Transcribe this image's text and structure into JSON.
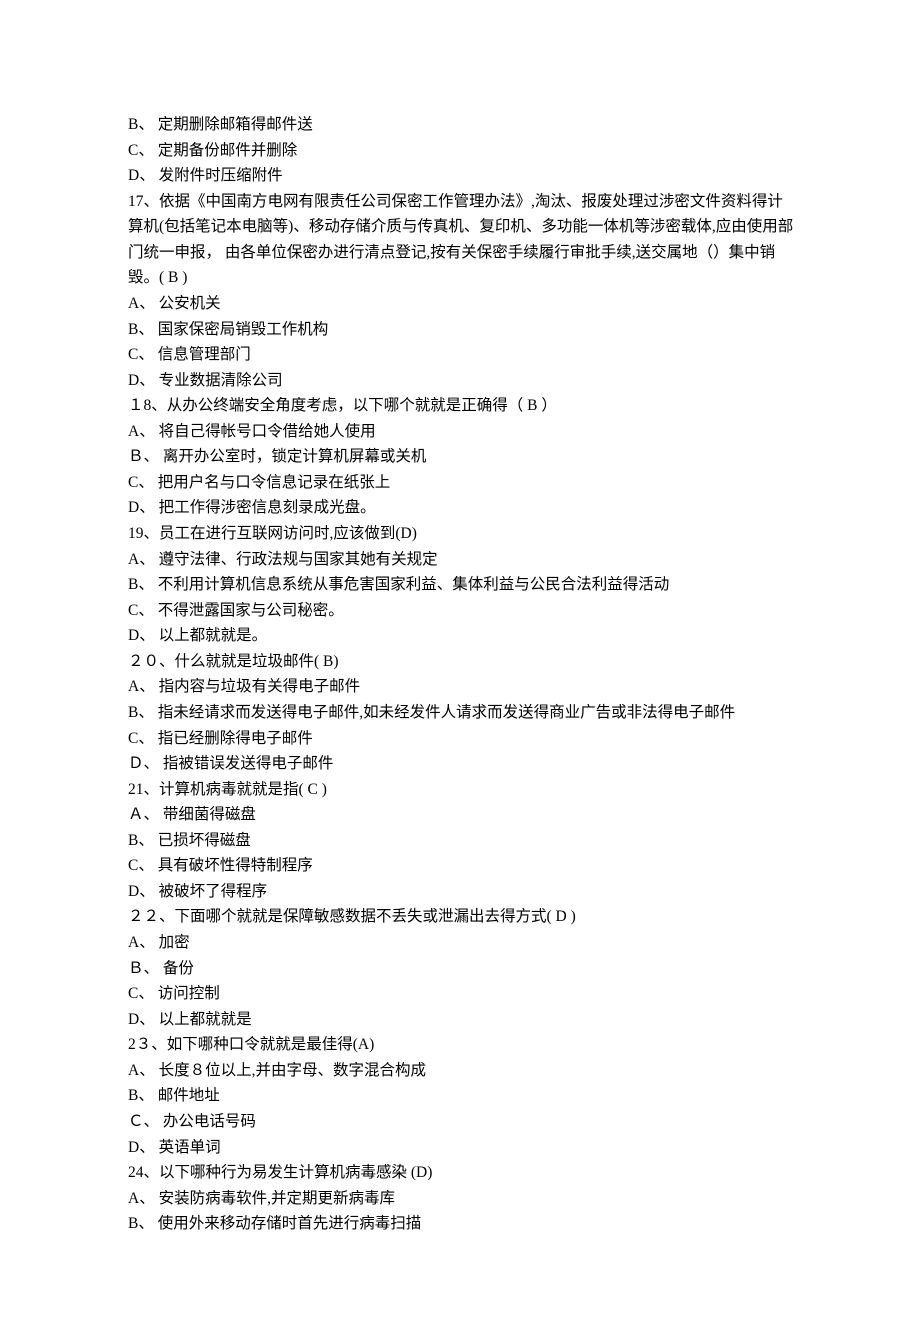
{
  "lines": [
    "B、  定期删除邮箱得邮件送",
    "C、   定期备份邮件并删除",
    "D、  发附件时压缩附件",
    "17、依据《中国南方电网有限责任公司保密工作管理办法》,淘汰、报废处理过涉密文件资料得计算机(包括笔记本电脑等)、移动存储介质与传真机、复印机、多功能一体机等涉密载体,应由使用部门统一申报， 由各单位保密办进行清点登记,按有关保密手续履行审批手续,送交属地（）集中销毁。(    B    )",
    "A、   公安机关",
    "B、   国家保密局销毁工作机构",
    "C、  信息管理部门",
    "D、   专业数据清除公司",
    "１8、从办公终端安全角度考虑，以下哪个就就是正确得（ B ）",
    "A、  将自己得帐号口令借给她人使用",
    "Ｂ、   离开办公室时，锁定计算机屏幕或关机",
    "C、  把用户名与口令信息记录在纸张上",
    "D、  把工作得涉密信息刻录成光盘。",
    "19、员工在进行互联网访问时,应该做到(D)",
    "A、  遵守法律、行政法规与国家其她有关规定",
    "B、  不利用计算机信息系统从事危害国家利益、集体利益与公民合法利益得活动",
    "C、  不得泄露国家与公司秘密。",
    "D、  以上都就就是。",
    "２０、什么就就是垃圾邮件( B)",
    "A、  指内容与垃圾有关得电子邮件",
    "B、  指未经请求而发送得电子邮件,如未经发件人请求而发送得商业广告或非法得电子邮件",
    "C、   指已经删除得电子邮件",
    "Ｄ、  指被错误发送得电子邮件",
    "21、计算机病毒就就是指( C )",
    "Ａ、  带细菌得磁盘",
    "B、  已损坏得磁盘",
    "C、  具有破坏性得特制程序",
    "D、   被破坏了得程序",
    "２２、下面哪个就就是保障敏感数据不丢失或泄漏出去得方式( D )",
    "A、  加密",
    "Ｂ、  备份",
    "C、  访问控制",
    "D、   以上都就就是",
    "2３、如下哪种口令就就是最佳得(A)",
    "A、  长度８位以上,并由字母、数字混合构成",
    "B、  邮件地址",
    "Ｃ、  办公电话号码",
    "D、   英语单词",
    "24、以下哪种行为易发生计算机病毒感染 (D)",
    "A、  安装防病毒软件,并定期更新病毒库",
    "B、  使用外来移动存储时首先进行病毒扫描"
  ]
}
